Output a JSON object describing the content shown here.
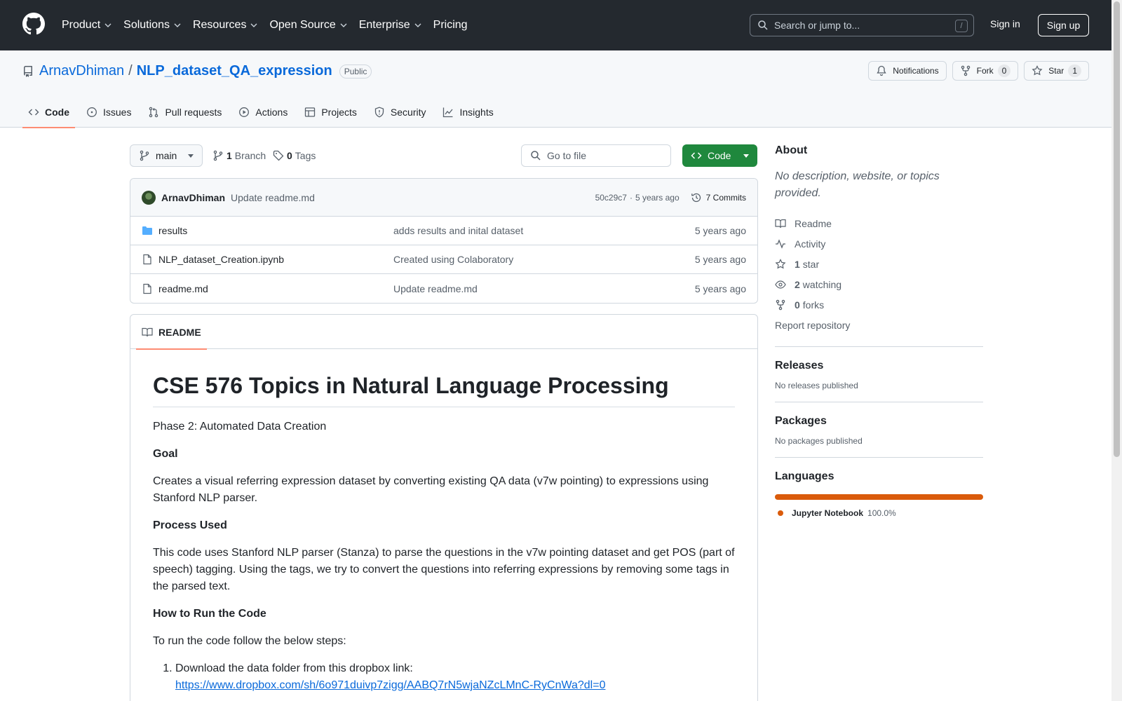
{
  "header": {
    "nav": [
      {
        "label": "Product"
      },
      {
        "label": "Solutions"
      },
      {
        "label": "Resources"
      },
      {
        "label": "Open Source"
      },
      {
        "label": "Enterprise"
      },
      {
        "label": "Pricing"
      }
    ],
    "search_placeholder": "Search or jump to...",
    "search_shortcut": "/",
    "sign_in": "Sign in",
    "sign_up": "Sign up"
  },
  "repo": {
    "owner": "ArnavDhiman",
    "separator": "/",
    "name": "NLP_dataset_QA_expression",
    "visibility": "Public",
    "notifications": "Notifications",
    "fork_label": "Fork",
    "fork_count": "0",
    "star_label": "Star",
    "star_count": "1"
  },
  "tabs": [
    {
      "label": "Code",
      "active": true
    },
    {
      "label": "Issues"
    },
    {
      "label": "Pull requests"
    },
    {
      "label": "Actions"
    },
    {
      "label": "Projects"
    },
    {
      "label": "Security"
    },
    {
      "label": "Insights"
    }
  ],
  "toolbar": {
    "branch": "main",
    "branch_count": "1",
    "branch_label": "Branch",
    "tag_count": "0",
    "tag_label": "Tags",
    "go_to_file": "Go to file",
    "code_button": "Code"
  },
  "latest_commit": {
    "author": "ArnavDhiman",
    "message": "Update readme.md",
    "hash": "50c29c7",
    "dot": "·",
    "time": "5 years ago",
    "commits": "7 Commits"
  },
  "files": [
    {
      "type": "folder",
      "name": "results",
      "message": "adds results and inital dataset",
      "time": "5 years ago"
    },
    {
      "type": "file",
      "name": "NLP_dataset_Creation.ipynb",
      "message": "Created using Colaboratory",
      "time": "5 years ago"
    },
    {
      "type": "file",
      "name": "readme.md",
      "message": "Update readme.md",
      "time": "5 years ago"
    }
  ],
  "readme": {
    "tab_label": "README",
    "title": "CSE 576 Topics in Natural Language Processing",
    "phase": "Phase 2: Automated Data Creation",
    "goal_heading": "Goal",
    "goal_text": "Creates a visual referring expression dataset by converting existing QA data (v7w pointing) to expressions using Stanford NLP parser.",
    "process_heading": "Process Used",
    "process_text": "This code uses Stanford NLP parser (Stanza) to parse the questions in the v7w pointing dataset and get POS (part of speech) tagging. Using the tags, we try to convert the questions into referring expressions by removing some tags in the parsed text.",
    "run_heading": "How to Run the Code",
    "run_intro": "To run the code follow the below steps:",
    "step1": "Download the data folder from this dropbox link:",
    "step1_link": "https://www.dropbox.com/sh/6o971duivp7zigg/AABQ7rN5wjaNZcLMnC-RyCnWa?dl=0"
  },
  "sidebar": {
    "about_heading": "About",
    "about_desc": "No description, website, or topics provided.",
    "readme": "Readme",
    "activity": "Activity",
    "stars_count": "1",
    "stars_label": "star",
    "watching_count": "2",
    "watching_label": "watching",
    "forks_count": "0",
    "forks_label": "forks",
    "report": "Report repository",
    "releases_heading": "Releases",
    "releases_text": "No releases published",
    "packages_heading": "Packages",
    "packages_text": "No packages published",
    "languages_heading": "Languages",
    "language_name": "Jupyter Notebook",
    "language_pct": "100.0%",
    "language_color": "#da5b0b"
  }
}
